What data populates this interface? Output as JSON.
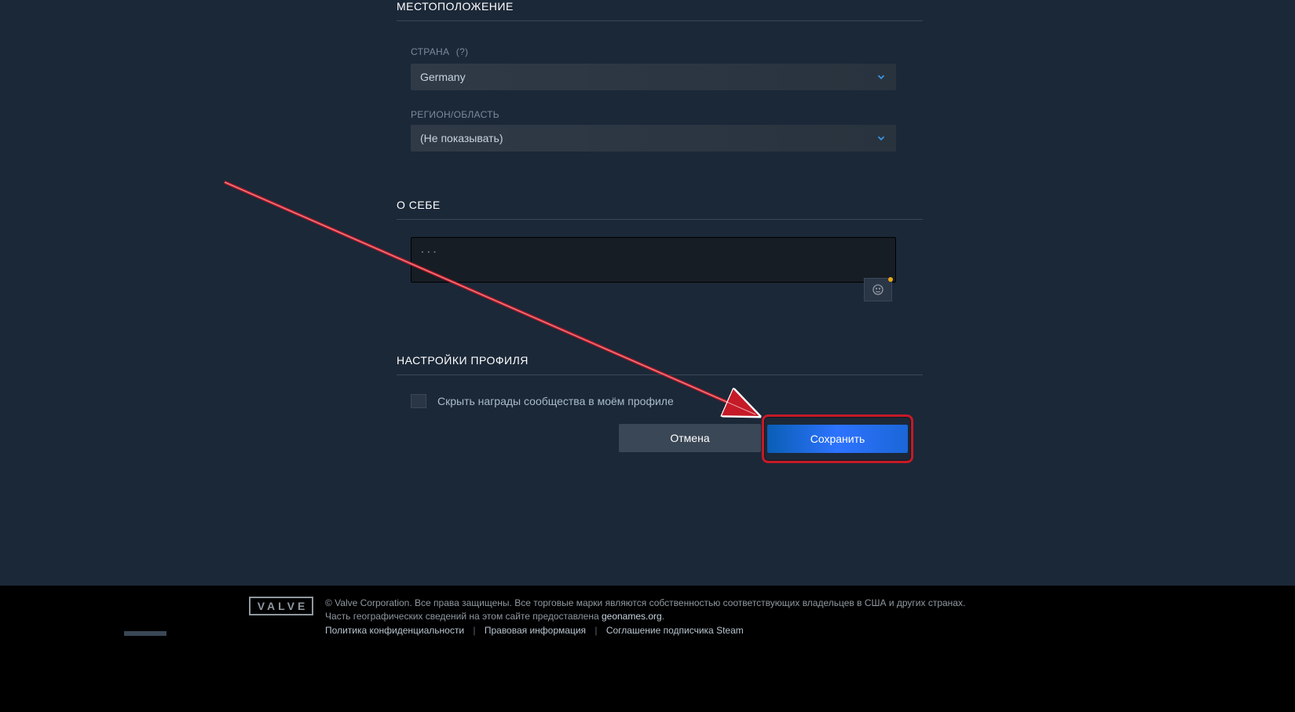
{
  "location": {
    "section_title": "МЕСТОПОЛОЖЕНИЕ",
    "country_label": "СТРАНА",
    "country_help": "(?)",
    "country_value": "Germany",
    "region_label": "РЕГИОН/ОБЛАСТЬ",
    "region_value": "(Не показывать)"
  },
  "about": {
    "section_title": "О СЕБЕ",
    "textarea_value": "",
    "textarea_placeholder": "..."
  },
  "profile_settings": {
    "section_title": "НАСТРОЙКИ ПРОФИЛЯ",
    "hide_awards_label": "Скрыть награды сообщества в моём профиле"
  },
  "actions": {
    "cancel_label": "Отмена",
    "save_label": "Сохранить"
  },
  "footer": {
    "logo_text": "VALVE",
    "copyright_line1": "© Valve Corporation. Все права защищены. Все торговые марки являются собственностью соответствующих владельцев в США и других странах.",
    "geo_prefix": "Часть географических сведений на этом сайте предоставлена ",
    "geo_link_text": "geonames.org",
    "geo_suffix": ".",
    "link_privacy": "Политика конфиденциальности",
    "link_legal": "Правовая информация",
    "link_ssa": "Соглашение подписчика Steam"
  },
  "colors": {
    "accent_blue": "#2d73ff",
    "highlight_red": "#c51a27"
  }
}
